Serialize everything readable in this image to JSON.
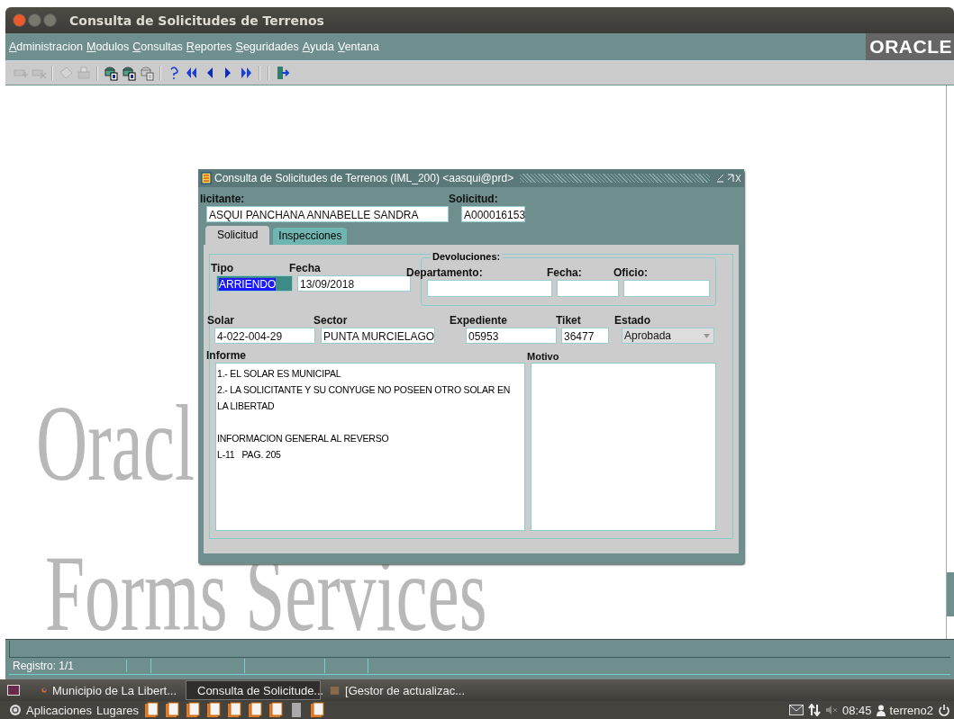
{
  "window": {
    "title": "Consulta de Solicitudes de Terrenos"
  },
  "menu": [
    "Administracion",
    "Modulos",
    "Consultas",
    "Reportes",
    "Seguridades",
    "Ayuda",
    "Ventana"
  ],
  "brand": "ORACLE",
  "toolbar": [
    {
      "kind": "insert",
      "disabled": true
    },
    {
      "kind": "delete",
      "disabled": true
    },
    {
      "kind": "sep"
    },
    {
      "kind": "save",
      "disabled": true
    },
    {
      "kind": "print",
      "disabled": true
    },
    {
      "kind": "sep"
    },
    {
      "kind": "query-enter",
      "disabled": false
    },
    {
      "kind": "query-run",
      "disabled": false
    },
    {
      "kind": "query-cancel",
      "disabled": true
    },
    {
      "kind": "sep"
    },
    {
      "kind": "help",
      "disabled": false
    },
    {
      "kind": "first",
      "disabled": false
    },
    {
      "kind": "prev",
      "disabled": false
    },
    {
      "kind": "next",
      "disabled": false
    },
    {
      "kind": "last",
      "disabled": false
    },
    {
      "kind": "sep"
    },
    {
      "kind": "sep"
    },
    {
      "kind": "exit",
      "disabled": false
    }
  ],
  "background_text": [
    "Oracl",
    "Forms Services"
  ],
  "dialog": {
    "title": "Consulta de Solicitudes de Terrenos (IML_200) <aasqui@prd>",
    "solicitante": {
      "label": "licitante:",
      "value": "ASQUI PANCHANA ANNABELLE SANDRA"
    },
    "solicitud": {
      "label": "Solicitud:",
      "value": "A000016153"
    },
    "tabs": [
      {
        "label": "Solicitud",
        "selected": true
      },
      {
        "label": "Inspecciones",
        "selected": false
      }
    ],
    "tipo": {
      "label": "Tipo",
      "value": "ARRIENDO",
      "highlighted": true
    },
    "fecha": {
      "label": "Fecha",
      "value": "13/09/2018"
    },
    "devoluciones": {
      "legend": "Devoluciones:",
      "fields": [
        {
          "label": "Departamento:"
        },
        {
          "label": "Fecha:"
        },
        {
          "label": "Oficio:"
        }
      ]
    },
    "row2": [
      {
        "label": "Solar",
        "value": "4-022-004-29",
        "kind": "text"
      },
      {
        "label": "Sector",
        "value": "PUNTA MURCIELAGO",
        "kind": "text"
      },
      {
        "label": "Expediente",
        "value": "05953",
        "kind": "text"
      },
      {
        "label": "Tiket",
        "value": "36477",
        "kind": "text"
      },
      {
        "label": "Estado",
        "value": "Aprobada",
        "kind": "select"
      }
    ],
    "informe": {
      "label": "Informe",
      "paragraphs": [
        [
          "1.- EL SOLAR ES MUNICIPAL",
          "2.- LA SOLICITANTE Y SU CONYUGE NO POSEEN OTRO SOLAR EN",
          "LA LIBERTAD"
        ],
        [
          "INFORMACION GENERAL AL REVERSO",
          "L-11   PAG. 205"
        ]
      ]
    },
    "motivo": {
      "label": "Motivo"
    }
  },
  "status_bar": {
    "record": "Registro: 1/1"
  },
  "taskbar": [
    {
      "label": "Municipio de La Libert...",
      "selected": false,
      "kind": "browser"
    },
    {
      "label": "Consulta de Solicitude...",
      "selected": true,
      "kind": "java"
    },
    {
      "label": "[Gestor de actualizac...",
      "selected": false,
      "kind": "package"
    }
  ],
  "panel": {
    "menus": [
      "Aplicaciones",
      "Lugares"
    ],
    "time": "08:45",
    "user": "terreno2"
  }
}
